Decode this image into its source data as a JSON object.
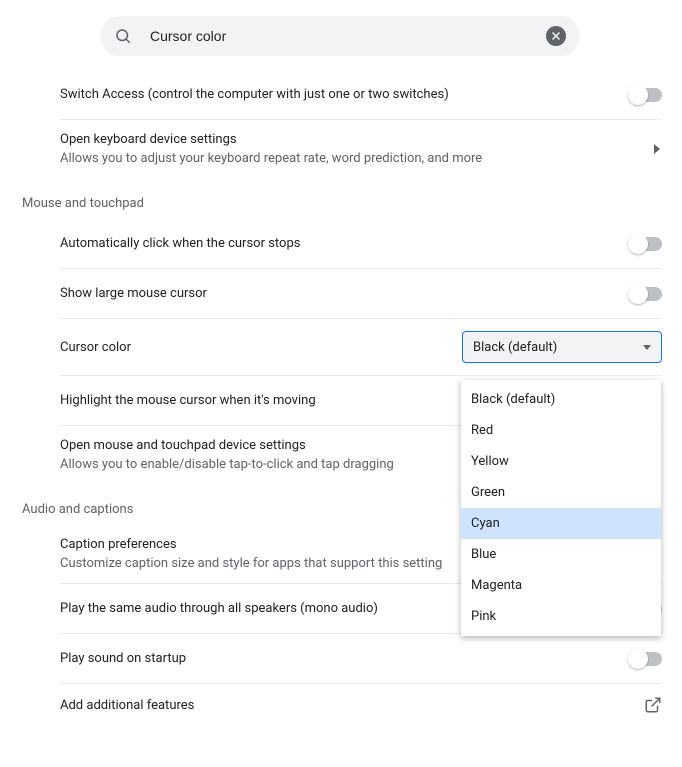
{
  "search": {
    "value": "Cursor color"
  },
  "rows": {
    "switchAccess": "Switch Access (control the computer with just one or two switches)",
    "keyboardTitle": "Open keyboard device settings",
    "keyboardSub": "Allows you to adjust your keyboard repeat rate, word prediction, and more"
  },
  "sections": {
    "mouse": "Mouse and touchpad",
    "audio": "Audio and captions"
  },
  "mouse": {
    "autoClick": "Automatically click when the cursor stops",
    "largeCursor": "Show large mouse cursor",
    "cursorColorLabel": "Cursor color",
    "cursorColorValue": "Black (default)",
    "highlight": "Highlight the mouse cursor when it's moving",
    "openMouseTitle": "Open mouse and touchpad device settings",
    "openMouseSub": "Allows you to enable/disable tap-to-click and tap dragging"
  },
  "cursorColorOptions": [
    "Black (default)",
    "Red",
    "Yellow",
    "Green",
    "Cyan",
    "Blue",
    "Magenta",
    "Pink"
  ],
  "cursorColorHighlighted": "Cyan",
  "audio": {
    "captionTitle": "Caption preferences",
    "captionSub": "Customize caption size and style for apps that support this setting",
    "mono": "Play the same audio through all speakers (mono audio)",
    "startup": "Play sound on startup",
    "addFeatures": "Add additional features"
  }
}
